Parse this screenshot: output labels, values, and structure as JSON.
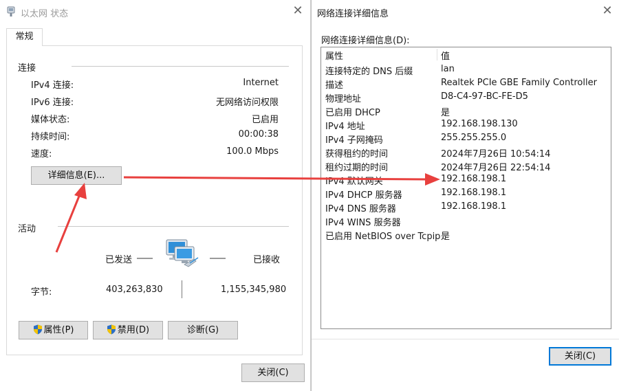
{
  "left": {
    "title": "以太网 状态",
    "tab": "常规",
    "connection": {
      "heading": "连接",
      "rows": [
        {
          "label": "IPv4 连接:",
          "value": "Internet"
        },
        {
          "label": "IPv6 连接:",
          "value": "无网络访问权限"
        },
        {
          "label": "媒体状态:",
          "value": "已启用"
        },
        {
          "label": "持续时间:",
          "value": "00:00:38"
        },
        {
          "label": "速度:",
          "value": "100.0 Mbps"
        }
      ],
      "details_button": "详细信息(E)..."
    },
    "activity": {
      "heading": "活动",
      "sent_label": "已发送",
      "received_label": "已接收",
      "bytes_label": "字节:",
      "bytes_sent": "403,263,830",
      "bytes_received": "1,155,345,980"
    },
    "buttons": {
      "properties": "属性(P)",
      "disable": "禁用(D)",
      "diagnose": "诊断(G)",
      "close": "关闭(C)"
    }
  },
  "right": {
    "title": "网络连接详细信息",
    "subtitle": "网络连接详细信息(D):",
    "columns": {
      "property": "属性",
      "value": "值"
    },
    "rows": [
      {
        "property": "连接特定的 DNS 后缀",
        "value": "lan"
      },
      {
        "property": "描述",
        "value": "Realtek PCIe GBE Family Controller"
      },
      {
        "property": "物理地址",
        "value": "D8-C4-97-BC-FE-D5"
      },
      {
        "property": "已启用 DHCP",
        "value": "是"
      },
      {
        "property": "IPv4 地址",
        "value": "192.168.198.130"
      },
      {
        "property": "IPv4 子网掩码",
        "value": "255.255.255.0"
      },
      {
        "property": "获得租约的时间",
        "value": "2024年7月26日 10:54:14"
      },
      {
        "property": "租约过期的时间",
        "value": "2024年7月26日 22:54:14"
      },
      {
        "property": "IPv4 默认网关",
        "value": "192.168.198.1"
      },
      {
        "property": "IPv4 DHCP 服务器",
        "value": "192.168.198.1"
      },
      {
        "property": "IPv4 DNS 服务器",
        "value": "192.168.198.1"
      },
      {
        "property": "IPv4 WINS 服务器",
        "value": ""
      },
      {
        "property": "已启用 NetBIOS over Tcpip",
        "value": "是"
      }
    ],
    "close_button": "关闭(C)"
  },
  "colors": {
    "annotation_arrow": "#e8403e",
    "focus_border": "#0078d7",
    "button_face": "#e1e1e1"
  }
}
